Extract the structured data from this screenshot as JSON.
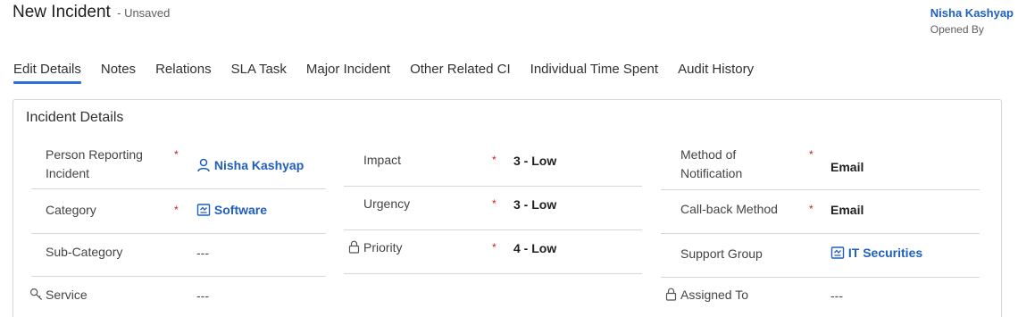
{
  "header": {
    "title": "New Incident",
    "status": "- Unsaved",
    "owner_name": "Nisha Kashyap",
    "owner_role": "Opened By"
  },
  "tabs": [
    {
      "label": "Edit Details",
      "active": true
    },
    {
      "label": "Notes"
    },
    {
      "label": "Relations"
    },
    {
      "label": "SLA Task"
    },
    {
      "label": "Major Incident"
    },
    {
      "label": "Other Related CI"
    },
    {
      "label": "Individual Time Spent"
    },
    {
      "label": "Audit History"
    }
  ],
  "section": {
    "title": "Incident Details",
    "col1": {
      "person_reporting": {
        "label_line1": "Person Reporting",
        "label_line2": "Incident",
        "required": "*",
        "value": "Nisha Kashyap",
        "icon": "person-icon"
      },
      "category": {
        "label": "Category",
        "required": "*",
        "value": "Software",
        "icon": "category-icon"
      },
      "sub_category": {
        "label": "Sub-Category",
        "value": "---"
      },
      "service": {
        "label": "Service",
        "value": "---",
        "icon": "search-key-icon"
      }
    },
    "col2": {
      "impact": {
        "label": "Impact",
        "required": "*",
        "value": "3 - Low"
      },
      "urgency": {
        "label": "Urgency",
        "required": "*",
        "value": "3 - Low"
      },
      "priority": {
        "label": "Priority",
        "required": "*",
        "value": "4 - Low",
        "icon": "lock-icon"
      }
    },
    "col3": {
      "method_notification": {
        "label_line1": "Method of",
        "label_line2": "Notification",
        "required": "*",
        "value": "Email"
      },
      "callback_method": {
        "label": "Call-back Method",
        "required": "*",
        "value": "Email"
      },
      "support_group": {
        "label": "Support Group",
        "value": "IT Securities",
        "icon": "group-icon"
      },
      "assigned_to": {
        "label": "Assigned To",
        "value": "---",
        "icon": "lock-icon"
      }
    }
  },
  "colors": {
    "link": "#1f5fbf",
    "tab_underline": "#2e6fd8",
    "required": "#c02020"
  }
}
